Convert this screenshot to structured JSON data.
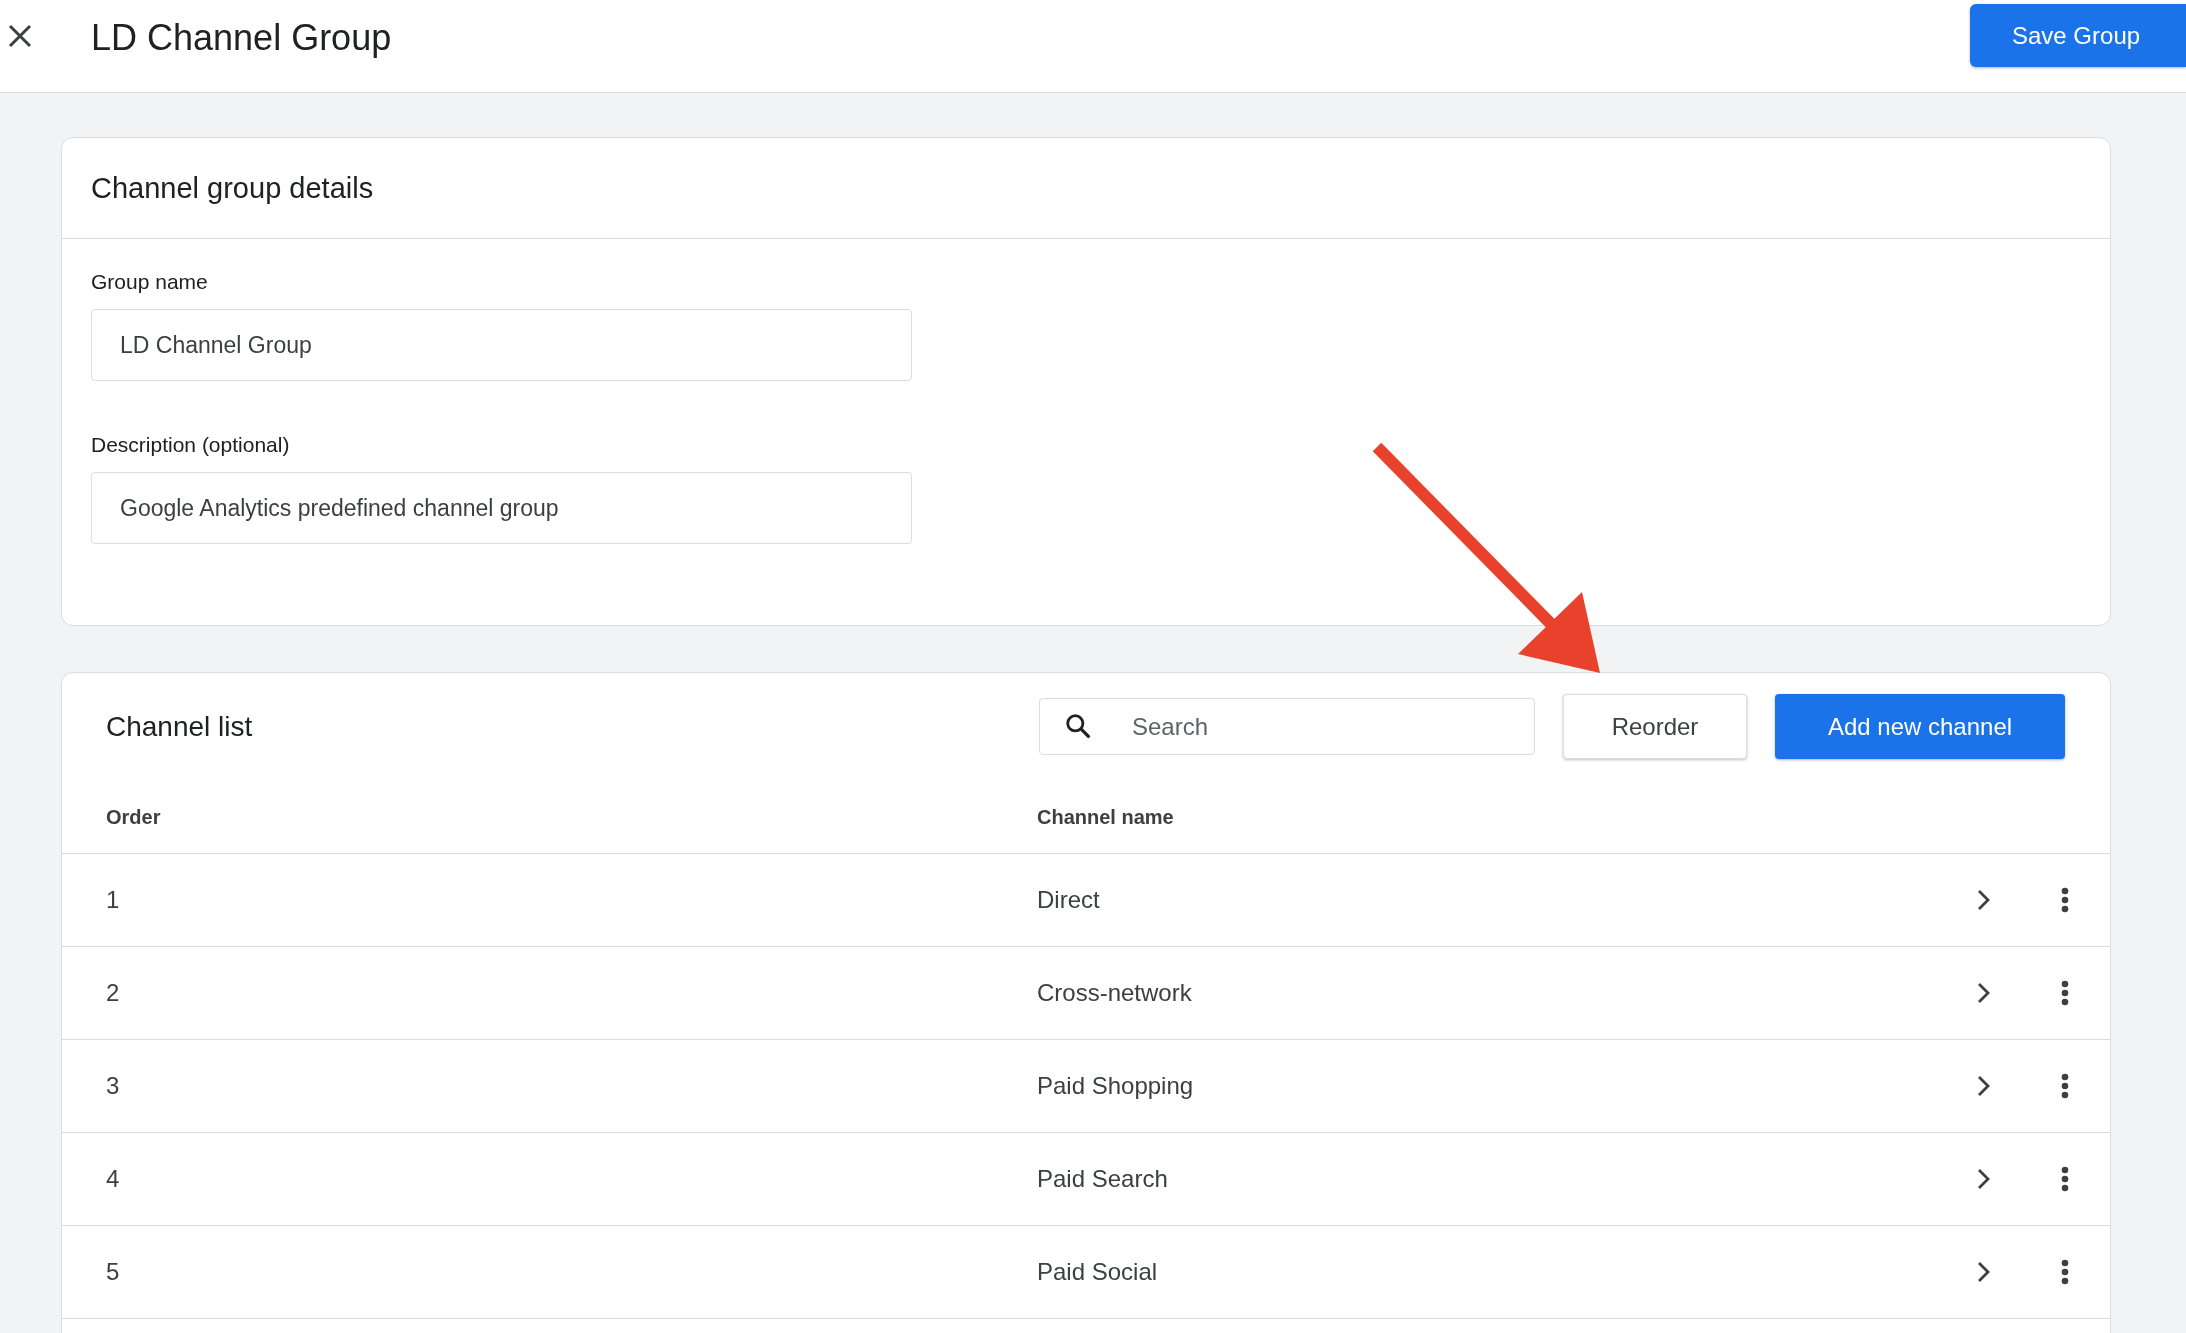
{
  "top_bar": {
    "title": "LD Channel Group",
    "save_button": "Save Group"
  },
  "details_card": {
    "title": "Channel group details",
    "fields": [
      {
        "label": "Group name",
        "value": "LD Channel Group"
      },
      {
        "label": "Description (optional)",
        "value": "Google Analytics predefined channel group"
      }
    ]
  },
  "channel_list": {
    "title": "Channel list",
    "search": {
      "placeholder": "Search"
    },
    "reorder_button": "Reorder",
    "add_button": "Add new channel",
    "columns": [
      "Order",
      "Channel name"
    ],
    "rows": [
      {
        "order": "1",
        "name": "Direct"
      },
      {
        "order": "2",
        "name": "Cross-network"
      },
      {
        "order": "3",
        "name": "Paid Shopping"
      },
      {
        "order": "4",
        "name": "Paid Search"
      },
      {
        "order": "5",
        "name": "Paid Social"
      }
    ]
  }
}
